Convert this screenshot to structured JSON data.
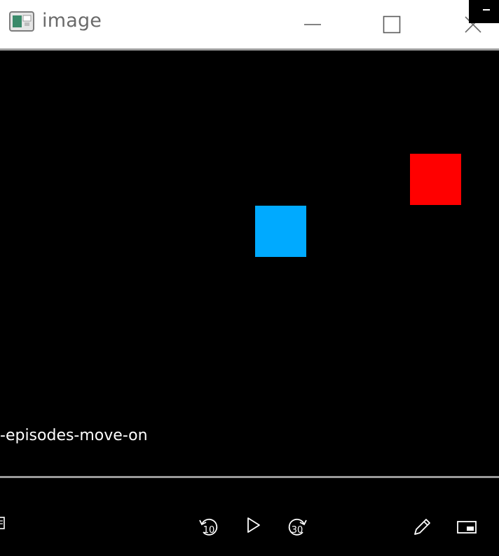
{
  "window": {
    "title": "image",
    "icon": "window-app-icon",
    "buttons": {
      "minimize": "minimize-icon",
      "maximize": "maximize-icon",
      "close": "close-icon"
    }
  },
  "game": {
    "background_color": "#000000",
    "agent_color": "#00aaff",
    "target_color": "#ff0000"
  },
  "player": {
    "caption": "-episodes-move-on",
    "progress": 1.0,
    "controls": {
      "rewind_seconds": "10",
      "forward_seconds": "30",
      "playlist_icon": "playlist-icon",
      "rewind_icon": "rewind-icon",
      "play_icon": "play-icon",
      "forward_icon": "forward-icon",
      "edit_icon": "pencil-icon",
      "miniview_icon": "mini-view-icon"
    }
  }
}
